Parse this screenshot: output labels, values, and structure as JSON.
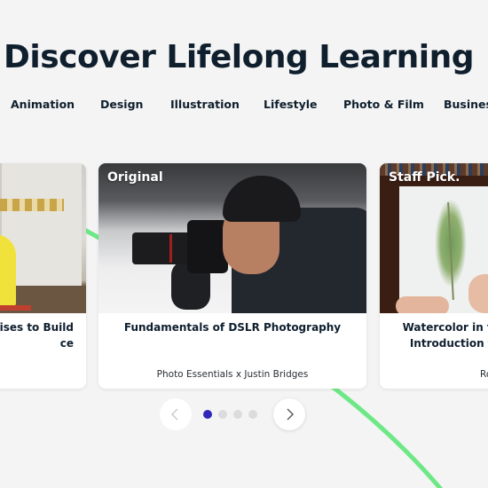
{
  "page": {
    "title": "Discover Lifelong Learning"
  },
  "categories": [
    {
      "label": "Animation"
    },
    {
      "label": "Design"
    },
    {
      "label": "Illustration"
    },
    {
      "label": "Lifestyle"
    },
    {
      "label": "Photo & Film"
    },
    {
      "label": "Business"
    }
  ],
  "cards": [
    {
      "badge": "",
      "title": "rcises to Build\nce",
      "author": ""
    },
    {
      "badge": "Original",
      "title": "Fundamentals of DSLR Photography",
      "author": "Photo Essentials x Justin Bridges"
    },
    {
      "badge": "Staff Pick.",
      "title": "Watercolor in the Wild: An Introduction to Painting",
      "author": "Ro"
    }
  ],
  "pager": {
    "prev_icon": "chevron-left-icon",
    "next_icon": "chevron-right-icon",
    "total_pages": 4,
    "active_page": 1
  },
  "colors": {
    "accent": "#3028b8",
    "decor_line": "#6ee886",
    "title": "#0f1f2e",
    "background": "#f4f4f4"
  }
}
